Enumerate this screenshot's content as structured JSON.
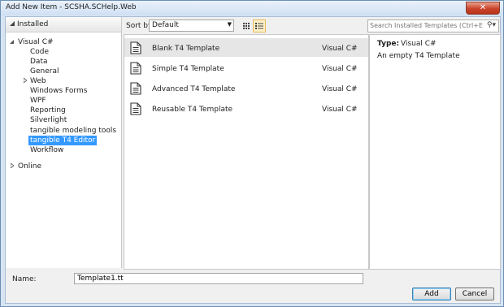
{
  "window": {
    "title": "Add New Item - SCSHA.SCHelp.Web"
  },
  "nav": {
    "installed_label": "Installed",
    "tree_root": "Visual C#",
    "tree_items": [
      "Code",
      "Data",
      "General",
      "Web",
      "Windows Forms",
      "WPF",
      "Reporting",
      "Silverlight",
      "tangible modeling tools",
      "tangible T4 Editor",
      "Workflow"
    ],
    "selected": "tangible T4 Editor",
    "online_label": "Online"
  },
  "toolbar": {
    "sort_label": "Sort by:",
    "sort_value": "Default",
    "search_placeholder": "Search Installed Templates (Ctrl+E)"
  },
  "templates": [
    {
      "name": "Blank T4 Template",
      "lang": "Visual C#"
    },
    {
      "name": "Simple T4 Template",
      "lang": "Visual C#"
    },
    {
      "name": "Advanced T4 Template",
      "lang": "Visual C#"
    },
    {
      "name": "Reusable T4 Template",
      "lang": "Visual C#"
    }
  ],
  "detail": {
    "type_label": "Type:",
    "type_value": "Visual C#",
    "description": "An empty T4 Template"
  },
  "name_field": {
    "label": "Name:",
    "value": "Template1.tt"
  },
  "buttons": {
    "add": "Add",
    "cancel": "Cancel"
  },
  "colors": {
    "selection": "#3399ff",
    "title_bar": "#cfe0f3",
    "close_button": "#c9442b"
  }
}
